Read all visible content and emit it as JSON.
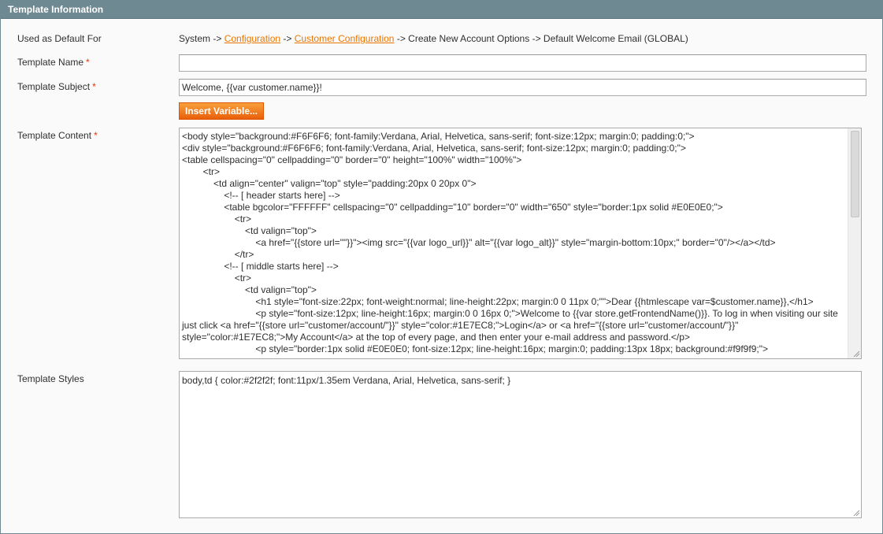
{
  "section": {
    "title": "Template Information"
  },
  "fields": {
    "default_for": {
      "label": "Used as Default For",
      "prefix": "System -> ",
      "link1": "Configuration",
      "sep1": " -> ",
      "link2": "Customer Configuration",
      "suffix": " -> Create New Account Options -> Default Welcome Email  (GLOBAL)"
    },
    "name": {
      "label": "Template Name",
      "required": "*",
      "value": ""
    },
    "subject": {
      "label": "Template Subject",
      "required": "*",
      "value": "Welcome, {{var customer.name}}!"
    },
    "insert_variable": {
      "label": "Insert Variable..."
    },
    "content": {
      "label": "Template Content",
      "required": "*",
      "value": "<body style=\"background:#F6F6F6; font-family:Verdana, Arial, Helvetica, sans-serif; font-size:12px; margin:0; padding:0;\">\n<div style=\"background:#F6F6F6; font-family:Verdana, Arial, Helvetica, sans-serif; font-size:12px; margin:0; padding:0;\">\n<table cellspacing=\"0\" cellpadding=\"0\" border=\"0\" height=\"100%\" width=\"100%\">\n        <tr>\n            <td align=\"center\" valign=\"top\" style=\"padding:20px 0 20px 0\">\n                <!-- [ header starts here] -->\n                <table bgcolor=\"FFFFFF\" cellspacing=\"0\" cellpadding=\"10\" border=\"0\" width=\"650\" style=\"border:1px solid #E0E0E0;\">\n                    <tr>\n                        <td valign=\"top\">\n                            <a href=\"{{store url=\"\"}}\"><img src=\"{{var logo_url}}\" alt=\"{{var logo_alt}}\" style=\"margin-bottom:10px;\" border=\"0\"/></a></td>\n                    </tr>\n                <!-- [ middle starts here] -->\n                    <tr>\n                        <td valign=\"top\">\n                            <h1 style=\"font-size:22px; font-weight:normal; line-height:22px; margin:0 0 11px 0;\"\">Dear {{htmlescape var=$customer.name}},</h1>\n                            <p style=\"font-size:12px; line-height:16px; margin:0 0 16px 0;\">Welcome to {{var store.getFrontendName()}}. To log in when visiting our site just click <a href=\"{{store url=\"customer/account/\"}}\" style=\"color:#1E7EC8;\">Login</a> or <a href=\"{{store url=\"customer/account/\"}}\" style=\"color:#1E7EC8;\">My Account</a> at the top of every page, and then enter your e-mail address and password.</p>\n                            <p style=\"border:1px solid #E0E0E0; font-size:12px; line-height:16px; margin:0; padding:13px 18px; background:#f9f9f9;\">"
    },
    "styles": {
      "label": "Template Styles",
      "value": "body,td { color:#2f2f2f; font:11px/1.35em Verdana, Arial, Helvetica, sans-serif; }"
    }
  }
}
